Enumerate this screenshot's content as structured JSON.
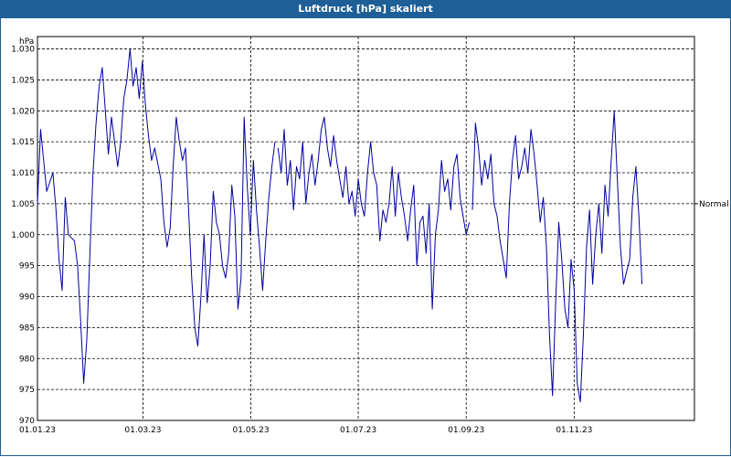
{
  "window": {
    "title": "Luftdruck [hPa] skaliert"
  },
  "colors": {
    "titlebar": "#1d5f96",
    "series": "#0000a0",
    "grid": "#000000"
  },
  "chart_data": {
    "type": "line",
    "title": "Luftdruck [hPa] skaliert",
    "ylabel": "hPa",
    "xlabel": "",
    "ylim": [
      970,
      1032
    ],
    "xlim": [
      "2023-01-01",
      "2023-12-31"
    ],
    "grid": true,
    "y_ticks": [
      "970",
      "975",
      "980",
      "985",
      "990",
      "995",
      "1.000",
      "1.005",
      "1.010",
      "1.015",
      "1.020",
      "1.025",
      "1.030"
    ],
    "x_ticks": [
      "01.01.23",
      "01.03.23",
      "01.05.23",
      "01.07.23",
      "01.09.23",
      "01.11.23"
    ],
    "reference_line": {
      "label": "Normal",
      "value": 1005
    },
    "series": [
      {
        "values": [
          [
            0,
            1005
          ],
          [
            1,
            1017
          ],
          [
            3,
            1007
          ],
          [
            5,
            1010
          ],
          [
            6,
            1004
          ],
          [
            7,
            996
          ],
          [
            8,
            991
          ],
          [
            9,
            1006
          ],
          [
            10,
            1000
          ],
          [
            12,
            999
          ],
          [
            13,
            995
          ],
          [
            14,
            986
          ],
          [
            15,
            976
          ],
          [
            16,
            983
          ],
          [
            17,
            997
          ],
          [
            18,
            1010
          ],
          [
            19,
            1018
          ],
          [
            20,
            1024
          ],
          [
            21,
            1027
          ],
          [
            22,
            1020
          ],
          [
            23,
            1013
          ],
          [
            24,
            1019
          ],
          [
            26,
            1011
          ],
          [
            27,
            1015
          ],
          [
            28,
            1022
          ],
          [
            29,
            1025
          ],
          [
            30,
            1030
          ],
          [
            31,
            1024
          ],
          [
            32,
            1027
          ],
          [
            33,
            1022
          ],
          [
            34,
            1028
          ],
          [
            35,
            1021
          ],
          [
            36,
            1016
          ],
          [
            37,
            1012
          ],
          [
            38,
            1014
          ],
          [
            40,
            1009
          ],
          [
            41,
            1002
          ],
          [
            42,
            998
          ],
          [
            43,
            1001
          ],
          [
            44,
            1011
          ],
          [
            45,
            1019
          ],
          [
            46,
            1015
          ],
          [
            47,
            1012
          ],
          [
            48,
            1014
          ],
          [
            49,
            1004
          ],
          [
            50,
            993
          ],
          [
            51,
            985
          ],
          [
            52,
            982
          ],
          [
            53,
            990
          ],
          [
            54,
            1000
          ],
          [
            55,
            989
          ],
          [
            56,
            995
          ],
          [
            57,
            1007
          ],
          [
            58,
            1002
          ],
          [
            59,
            1000
          ],
          [
            60,
            995
          ],
          [
            61,
            993
          ],
          [
            62,
            997
          ],
          [
            63,
            1008
          ],
          [
            64,
            1003
          ],
          [
            65,
            988
          ],
          [
            66,
            993
          ],
          [
            67,
            1019
          ],
          [
            68,
            1008
          ],
          [
            69,
            1000
          ],
          [
            70,
            1012
          ],
          [
            71,
            1004
          ],
          [
            72,
            998
          ],
          [
            73,
            991
          ],
          [
            74,
            999
          ],
          [
            75,
            1006
          ],
          [
            76,
            1011
          ],
          [
            77,
            1015
          ]
        ]
      },
      {
        "values": [
          [
            78,
            1014
          ],
          [
            79,
            1010
          ],
          [
            80,
            1017
          ],
          [
            81,
            1008
          ],
          [
            82,
            1012
          ],
          [
            83,
            1004
          ],
          [
            84,
            1011
          ],
          [
            85,
            1009
          ],
          [
            86,
            1015
          ],
          [
            87,
            1005
          ],
          [
            88,
            1010
          ],
          [
            89,
            1013
          ],
          [
            90,
            1008
          ],
          [
            91,
            1012
          ],
          [
            92,
            1017
          ],
          [
            93,
            1019
          ],
          [
            94,
            1014
          ],
          [
            95,
            1011
          ],
          [
            96,
            1016
          ],
          [
            97,
            1012
          ],
          [
            98,
            1009
          ],
          [
            99,
            1006
          ],
          [
            100,
            1011
          ],
          [
            101,
            1005
          ],
          [
            102,
            1007
          ],
          [
            103,
            1003
          ],
          [
            104,
            1009
          ],
          [
            105,
            1005
          ],
          [
            106,
            1003
          ],
          [
            107,
            1010
          ],
          [
            108,
            1015
          ],
          [
            109,
            1010
          ],
          [
            110,
            1008
          ],
          [
            111,
            999
          ],
          [
            112,
            1004
          ],
          [
            113,
            1002
          ],
          [
            114,
            1005
          ],
          [
            115,
            1011
          ],
          [
            116,
            1003
          ],
          [
            117,
            1010
          ],
          [
            118,
            1006
          ],
          [
            119,
            1003
          ],
          [
            120,
            999
          ],
          [
            121,
            1004
          ],
          [
            122,
            1008
          ],
          [
            123,
            995
          ],
          [
            124,
            1002
          ],
          [
            125,
            1003
          ],
          [
            126,
            997
          ],
          [
            127,
            1005
          ],
          [
            128,
            988
          ],
          [
            129,
            1000
          ],
          [
            130,
            1004
          ],
          [
            131,
            1012
          ],
          [
            132,
            1007
          ],
          [
            133,
            1009
          ],
          [
            134,
            1004
          ],
          [
            135,
            1011
          ],
          [
            136,
            1013
          ],
          [
            137,
            1006
          ],
          [
            138,
            1003
          ],
          [
            139,
            1000
          ],
          [
            140,
            1002
          ]
        ]
      },
      {
        "values": [
          [
            141,
            1004
          ],
          [
            142,
            1018
          ],
          [
            143,
            1014
          ],
          [
            144,
            1008
          ],
          [
            145,
            1012
          ],
          [
            146,
            1009
          ],
          [
            147,
            1013
          ],
          [
            148,
            1005
          ],
          [
            149,
            1003
          ],
          [
            150,
            999
          ],
          [
            151,
            996
          ],
          [
            152,
            993
          ],
          [
            153,
            1005
          ],
          [
            154,
            1012
          ],
          [
            155,
            1016
          ],
          [
            156,
            1009
          ],
          [
            157,
            1011
          ],
          [
            158,
            1014
          ],
          [
            159,
            1010
          ],
          [
            160,
            1017
          ],
          [
            161,
            1013
          ],
          [
            162,
            1008
          ],
          [
            163,
            1002
          ],
          [
            164,
            1006
          ],
          [
            165,
            998
          ],
          [
            166,
            984
          ],
          [
            167,
            974
          ],
          [
            168,
            989
          ],
          [
            169,
            1002
          ],
          [
            170,
            996
          ],
          [
            171,
            988
          ],
          [
            172,
            985
          ],
          [
            173,
            996
          ],
          [
            174,
            991
          ],
          [
            175,
            976
          ],
          [
            176,
            973
          ],
          [
            177,
            984
          ],
          [
            178,
            998
          ],
          [
            179,
            1004
          ],
          [
            180,
            992
          ],
          [
            181,
            1000
          ],
          [
            182,
            1005
          ],
          [
            183,
            997
          ],
          [
            184,
            1008
          ],
          [
            185,
            1003
          ],
          [
            186,
            1012
          ],
          [
            187,
            1020
          ],
          [
            188,
            1009
          ],
          [
            189,
            998
          ],
          [
            190,
            992
          ],
          [
            191,
            994
          ],
          [
            192,
            996
          ],
          [
            193,
            1006
          ],
          [
            194,
            1011
          ],
          [
            195,
            1003
          ],
          [
            196,
            992
          ]
        ]
      }
    ]
  }
}
